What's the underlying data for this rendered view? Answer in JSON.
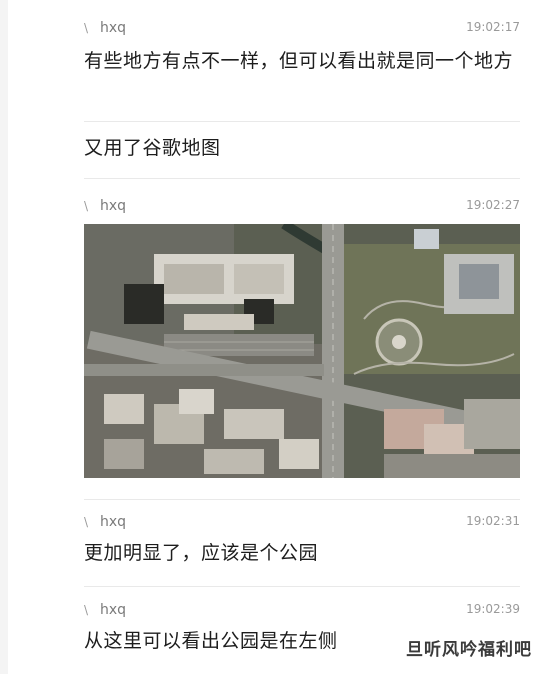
{
  "messages": [
    {
      "sender": "hxq",
      "time": "19:02:17",
      "text": "有些地方有点不一样，但可以看出就是同一个地方"
    },
    {
      "text": "又用了谷歌地图"
    },
    {
      "sender": "hxq",
      "time": "19:02:27",
      "image": "satellite-map"
    },
    {
      "sender": "hxq",
      "time": "19:02:31",
      "text": "更加明显了，应该是个公园"
    },
    {
      "sender": "hxq",
      "time": "19:02:39",
      "text": "从这里可以看出公园是在左侧"
    }
  ],
  "watermark": "旦听风吟福利吧",
  "colors": {
    "divider": "#e9e9e9",
    "meta_text": "#7a7a7a",
    "body_text": "#1d1d1d"
  }
}
